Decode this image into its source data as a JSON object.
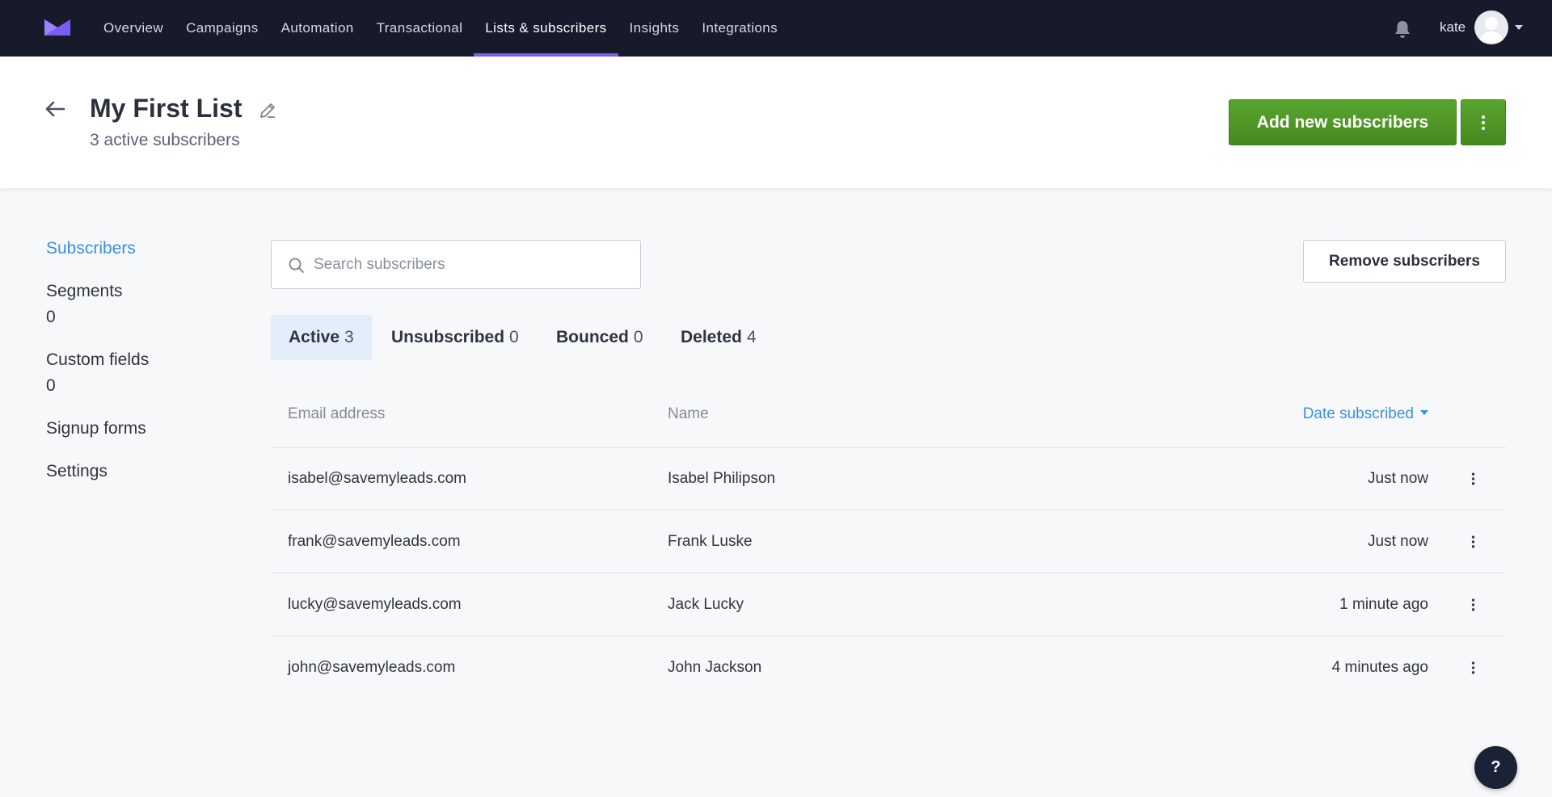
{
  "nav": {
    "items": [
      {
        "label": "Overview"
      },
      {
        "label": "Campaigns"
      },
      {
        "label": "Automation"
      },
      {
        "label": "Transactional"
      },
      {
        "label": "Lists & subscribers",
        "active": true
      },
      {
        "label": "Insights"
      },
      {
        "label": "Integrations"
      }
    ],
    "user": "kate"
  },
  "header": {
    "title": "My First List",
    "subtitle": "3 active subscribers",
    "add_button": "Add new subscribers"
  },
  "sidebar": {
    "subscribers": "Subscribers",
    "segments": "Segments",
    "segments_count": "0",
    "custom_fields": "Custom fields",
    "custom_fields_count": "0",
    "signup_forms": "Signup forms",
    "settings": "Settings"
  },
  "search": {
    "placeholder": "Search subscribers"
  },
  "remove_button": "Remove subscribers",
  "tabs": [
    {
      "label": "Active",
      "count": "3"
    },
    {
      "label": "Unsubscribed",
      "count": "0"
    },
    {
      "label": "Bounced",
      "count": "0"
    },
    {
      "label": "Deleted",
      "count": "4"
    }
  ],
  "table": {
    "columns": {
      "email": "Email address",
      "name": "Name",
      "date": "Date subscribed"
    },
    "rows": [
      {
        "email": "isabel@savemyleads.com",
        "name": "Isabel Philipson",
        "date": "Just now"
      },
      {
        "email": "frank@savemyleads.com",
        "name": "Frank Luske",
        "date": "Just now"
      },
      {
        "email": "lucky@savemyleads.com",
        "name": "Jack Lucky",
        "date": "1 minute ago"
      },
      {
        "email": "john@savemyleads.com",
        "name": "John Jackson",
        "date": "4 minutes ago"
      }
    ]
  },
  "help_label": "?",
  "colors": {
    "nav_bg": "#161a2b",
    "accent_purple": "#7b5cf5",
    "primary_green": "#4c9625",
    "link_blue": "#3d8fe0"
  }
}
